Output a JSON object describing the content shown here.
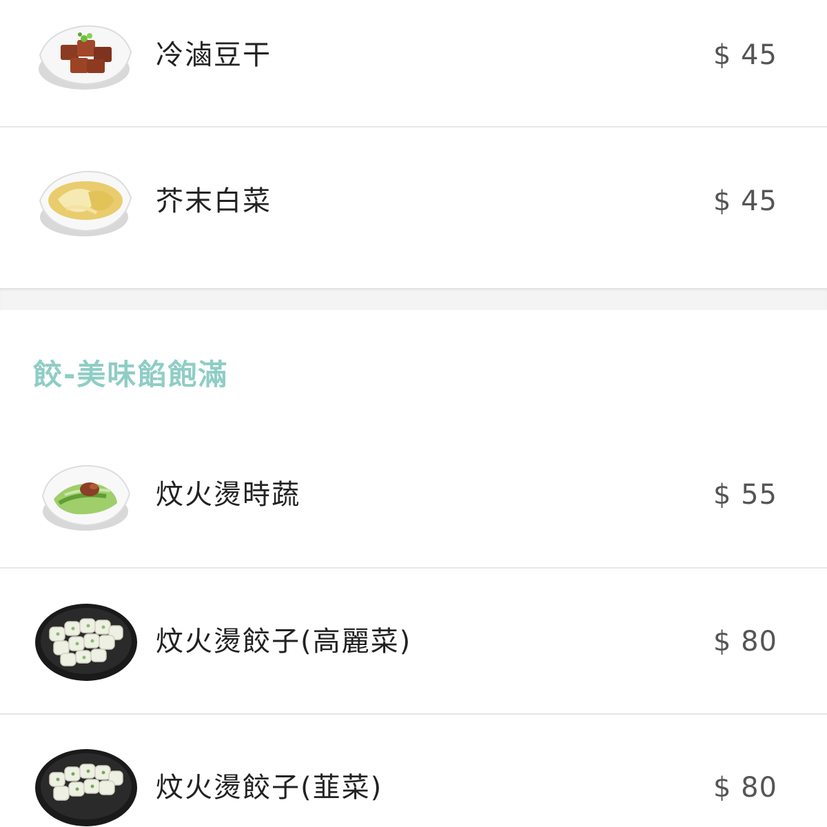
{
  "colors": {
    "section_title": "#8fcdc5",
    "price": "#555555",
    "name": "#222222",
    "divider": "#e6e6e6"
  },
  "items_top": [
    {
      "name": "冷滷豆干",
      "price": "$ 45",
      "icon": "braised-tofu-dish-icon"
    },
    {
      "name": "芥末白菜",
      "price": "$ 45",
      "icon": "mustard-cabbage-dish-icon"
    }
  ],
  "section": {
    "title": "餃-美味餡飽滿"
  },
  "items_section": [
    {
      "name": "炆火燙時蔬",
      "price": "$ 55",
      "icon": "blanched-vegetables-dish-icon"
    },
    {
      "name": "炆火燙餃子(高麗菜)",
      "price": "$ 80",
      "icon": "cabbage-dumplings-plate-icon"
    },
    {
      "name": "炆火燙餃子(韮菜)",
      "price": "$ 80",
      "icon": "chive-dumplings-plate-icon"
    }
  ]
}
